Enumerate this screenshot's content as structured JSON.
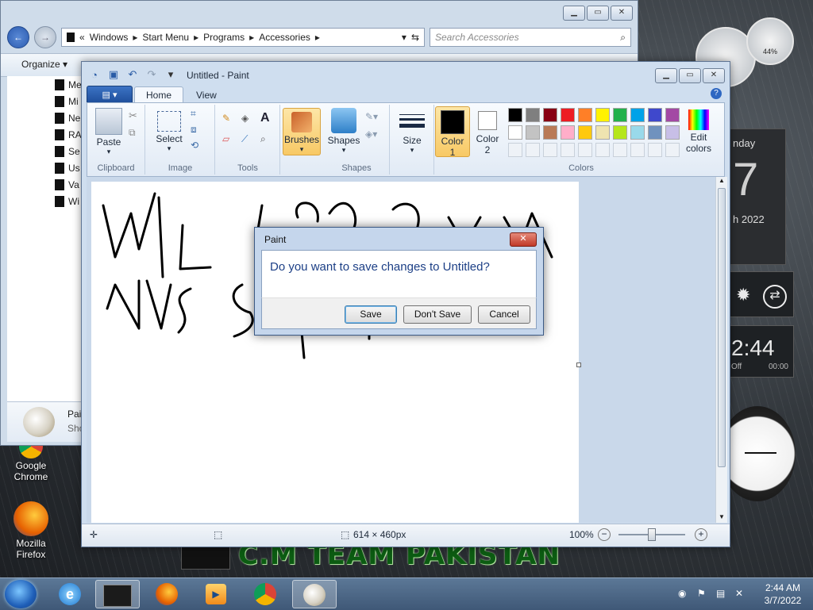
{
  "explorer": {
    "breadcrumb": [
      "Windows",
      "Start Menu",
      "Programs",
      "Accessories"
    ],
    "search_placeholder": "Search Accessories",
    "organize_label": "Organize",
    "nav_items": [
      "Me",
      "Mi",
      "Ne",
      "RA",
      "Se",
      "Us",
      "Va",
      "Wi"
    ],
    "details_name": "Pai",
    "details_sub": "Sho"
  },
  "paint": {
    "title": "Untitled - Paint",
    "tabs": [
      "Home",
      "View"
    ],
    "groups": {
      "clipboard": "Clipboard",
      "image": "Image",
      "tools": "Tools",
      "shapes": "Shapes",
      "colors": "Colors"
    },
    "buttons": {
      "paste": "Paste",
      "select": "Select",
      "brushes": "Brushes",
      "shapes": "Shapes",
      "size": "Size",
      "color1_line1": "Color",
      "color1_line2": "1",
      "color2_line1": "Color",
      "color2_line2": "2",
      "edit_colors_line1": "Edit",
      "edit_colors_line2": "colors"
    },
    "palette_row1": [
      "#000000",
      "#7f7f7f",
      "#880015",
      "#ed1c24",
      "#ff7f27",
      "#fff200",
      "#22b14c",
      "#00a2e8",
      "#3f48cc",
      "#a349a4"
    ],
    "palette_row2": [
      "#ffffff",
      "#c3c3c3",
      "#b97a57",
      "#ffaec9",
      "#ffc90e",
      "#efe4b0",
      "#b5e61d",
      "#99d9ea",
      "#7092be",
      "#c8bfe7"
    ],
    "color1": "#000000",
    "color2": "#ffffff",
    "status": {
      "size": "614 × 460px",
      "zoom": "100%"
    }
  },
  "dialog": {
    "title": "Paint",
    "message": "Do you want to save changes to Untitled?",
    "save": "Save",
    "dont_save": "Don't Save",
    "cancel": "Cancel"
  },
  "desktop": {
    "icons": [
      {
        "line1": "Google",
        "line2": "Chrome"
      },
      {
        "line1": "Mozilla",
        "line2": "Firefox"
      }
    ],
    "banner": "C.M TEAM PAKISTAN",
    "gadgets": {
      "battery": "44%",
      "calendar_day": "nday",
      "calendar_date": "7",
      "calendar_month": "h 2022",
      "timer_time": "2:44",
      "timer_off": "Off",
      "timer_elapsed": "00:00"
    }
  },
  "taskbar": {
    "time": "2:44 AM",
    "date": "3/7/2022"
  }
}
